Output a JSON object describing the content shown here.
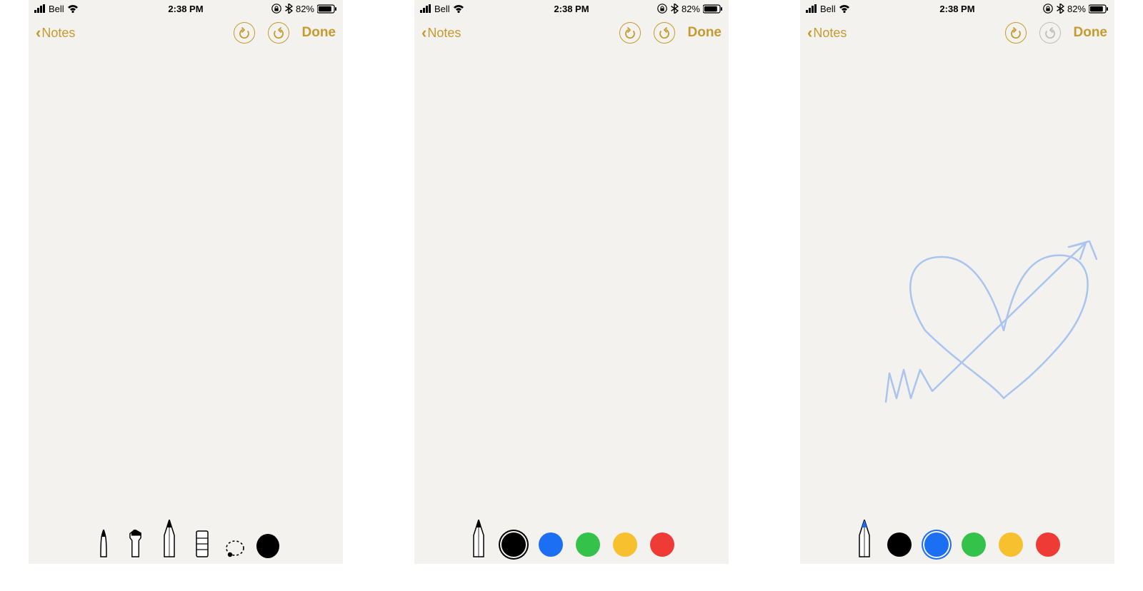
{
  "statusbar": {
    "carrier": "Bell",
    "time": "2:38 PM",
    "battery": "82%"
  },
  "nav": {
    "back": "Notes",
    "done": "Done"
  },
  "colors": {
    "accent": "#c79a2e",
    "black": "#000000",
    "blue": "#1c6ef2",
    "green": "#35c24b",
    "yellow": "#f6c02e",
    "red": "#ef3b36",
    "sketchBlue": "#a9c4ef"
  },
  "tools": {
    "pen": "pen-tool",
    "marker": "marker-tool",
    "pencil": "pencil-tool",
    "ruler": "eraser-tool",
    "lasso": "lasso-tool",
    "color": "color-swatch"
  },
  "screens": [
    {
      "id": "screen-1",
      "redoEnabled": true,
      "toolbar": "tools",
      "selectedColor": "black",
      "hasSketch": false
    },
    {
      "id": "screen-2",
      "redoEnabled": true,
      "toolbar": "colors",
      "selectedColor": "black",
      "hasSketch": false
    },
    {
      "id": "screen-3",
      "redoEnabled": false,
      "toolbar": "colors",
      "selectedColor": "blue",
      "hasSketch": true
    }
  ]
}
